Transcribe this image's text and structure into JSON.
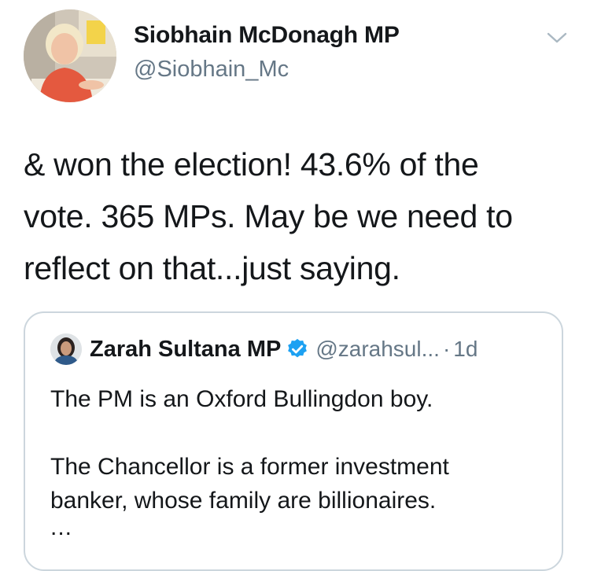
{
  "author": {
    "name": "Siobhain McDonagh MP",
    "handle": "@Siobhain_Mc"
  },
  "tweet": {
    "lines": [
      "& won the election! 43.6% of the",
      "vote. 365 MPs. May be we need to",
      "reflect on that...just saying."
    ]
  },
  "quoted_tweet": {
    "name": "Zarah Sultana MP",
    "verified": true,
    "handle": "@zarahsul...",
    "separator": "·",
    "time": "1d",
    "paragraph_1": "The PM is an Oxford Bullingdon boy.",
    "paragraph_2_lines": [
      "The Chancellor is a former investment",
      "banker, whose family are billionaires."
    ],
    "ellipsis": "..."
  },
  "icons": {
    "menu": "chevron-down-icon",
    "verified": "verified-badge-icon"
  },
  "colors": {
    "text": "#14171a",
    "secondary": "#657786",
    "border": "#ccd6dd",
    "verified_blue": "#1da1f2"
  }
}
